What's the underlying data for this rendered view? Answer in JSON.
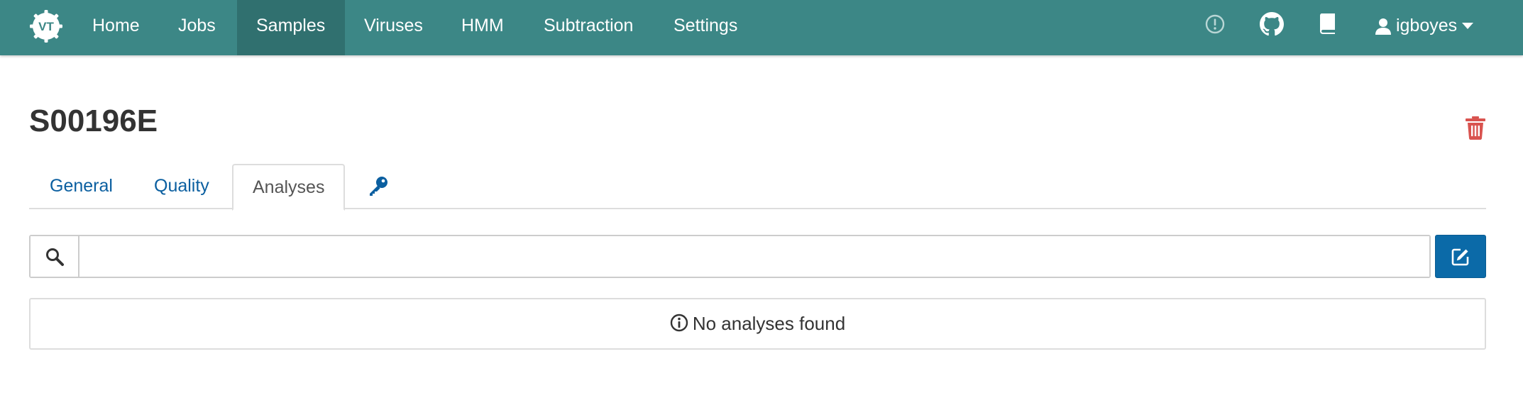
{
  "navbar": {
    "brand_logo": "virtool-logo-icon",
    "items": [
      {
        "label": "Home"
      },
      {
        "label": "Jobs"
      },
      {
        "label": "Samples",
        "active": true
      },
      {
        "label": "Viruses"
      },
      {
        "label": "HMM"
      },
      {
        "label": "Subtraction"
      },
      {
        "label": "Settings"
      }
    ],
    "right_icons": [
      "alert-circle-icon",
      "github-icon",
      "book-icon"
    ],
    "user": {
      "name": "igboyes",
      "icon": "user-icon",
      "dropdown_icon": "caret-down-icon"
    },
    "colors": {
      "background": "#3c8786",
      "active": "#30706f"
    }
  },
  "sample": {
    "title": "S00196E",
    "delete_icon": "trash-icon"
  },
  "tabs": [
    {
      "label": "General"
    },
    {
      "label": "Quality"
    },
    {
      "label": "Analyses",
      "active": true
    },
    {
      "label": "",
      "icon": "key-icon"
    }
  ],
  "search": {
    "icon": "search-icon",
    "value": "",
    "placeholder": ""
  },
  "create_button": {
    "icon": "edit-icon",
    "color": "#0b6aa8"
  },
  "empty_state": {
    "icon": "info-circle-icon",
    "message": "No analyses found"
  },
  "colors": {
    "link": "#0b5fa0",
    "danger": "#d9534f"
  }
}
